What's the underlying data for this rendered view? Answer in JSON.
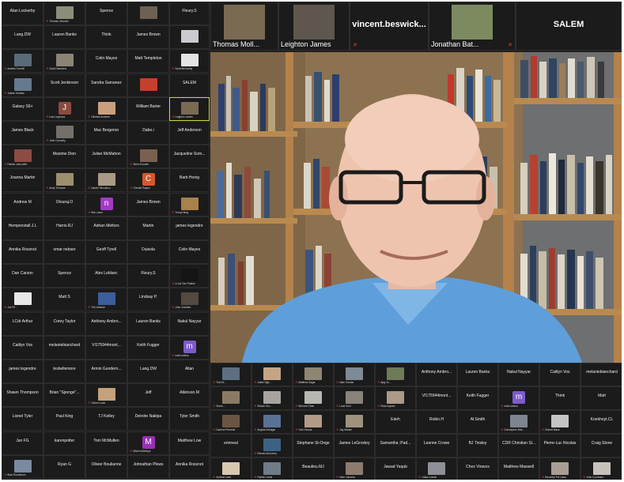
{
  "app": {
    "name": "Zoom gallery view"
  },
  "top_strip": [
    {
      "name": "Thomas Moll...",
      "kind": "video",
      "bg": "#7b6a52",
      "muted": false
    },
    {
      "name": "Leighton James",
      "kind": "video",
      "bg": "#5f564d",
      "muted": false
    },
    {
      "name": "vincent.beswick...",
      "kind": "name",
      "muted": true
    },
    {
      "name": "Jonathan Bat...",
      "kind": "video",
      "bg": "#7d8a60",
      "muted": true
    },
    {
      "name": "SALEM",
      "kind": "name",
      "muted": false
    }
  ],
  "active_speaker": {
    "label": "Active speaker video",
    "wall_color": "#8e7453",
    "shirt_color": "#5e9fdb"
  },
  "left_grid": [
    [
      "Alan Lockerby",
      {
        "thumb": "#8a8f7a",
        "label": "Thomas Vermiett"
      },
      "Spence",
      {
        "thumb": "#6d6252"
      },
      "Fleury.S"
    ],
    [
      "Lang.DW",
      "Lauren Banks",
      "Think",
      "James Brown",
      {
        "thumb": "#c9cbd0"
      }
    ],
    [
      {
        "thumb": "#5b6a78",
        "label": "andrew Tunnell"
      },
      {
        "thumb": "#8c8377",
        "label": "Sodhi Wardens"
      },
      "Colin Mayes",
      "Matt Templeton",
      {
        "thumb": "#e3e3e3",
        "label": "Scott McCarthy"
      }
    ],
    [
      {
        "thumb": "#657a8c",
        "label": "Jubran Kunbac"
      },
      "Scott Jenkinson",
      "Sandra Samanez",
      {
        "thumb": "#c4402e"
      },
      "SALEM"
    ],
    [
      "Galaxy S9+",
      {
        "init": "J",
        "color": "#8a4b3f",
        "label": "Ivan Leymans"
      },
      {
        "thumb": "#c9a07d",
        "label": "Gilmina Annetee"
      },
      "William Barter",
      {
        "thumb": "#7b6a52",
        "label": "Leighton James",
        "hl": true
      }
    ],
    [
      "James Black",
      {
        "thumb": "#73706a",
        "label": "John Connelly"
      },
      "Mac Bergeron",
      "Dabo.i",
      "Jeff Anderson"
    ],
    [
      {
        "thumb": "#8b4c43",
        "label": "Patrick Lamonthe"
      },
      "Maxime Dion",
      "Julian McMahon",
      {
        "thumb": "#7a6050",
        "label": "Steve Knowle"
      },
      "Jacqueline Som..."
    ],
    [
      "Joanna Martin",
      {
        "thumb": "#9c8f6e",
        "label": "Andy Terrance"
      },
      {
        "thumb": "#a89a84",
        "label": "Daniel Tchouikou"
      },
      {
        "init": "C",
        "color": "#d5582b",
        "label": "Christel Payton"
      },
      "Barb Honig"
    ],
    [
      "Andrew M",
      "Otsuraj.O",
      {
        "init": "n",
        "color": "#a33bc4",
        "label": "Bob Lauer"
      },
      "James Brown",
      {
        "thumb": "#a8814b",
        "label": "Trung Heng"
      }
    ],
    [
      "Hempenstall.J.L",
      "Harris.RJ",
      "Adrian Meltors",
      "Martin",
      "james legendre"
    ],
    [
      "Annika Rossnot",
      "omar nebser",
      "Geoff Tyrell",
      "Duisola",
      "Colin Mayes"
    ],
    [
      "Dan Carson",
      "Spence",
      "Alex Leblanc",
      "Fleury.S",
      {
        "thumb": "#151515",
        "label": "Lt-col Tom Pasker"
      }
    ],
    [
      {
        "thumb": "#e8e8e8",
        "label": "Joe Pil..."
      },
      "Matt S",
      {
        "thumb": "#3d5e9c",
        "label": "Tim Volstore"
      },
      "Lindsay P.",
      {
        "thumb": "#55493f",
        "label": "John Goulbert"
      }
    ],
    [
      "LCdr Arthur",
      "Corey Taylor",
      "Anthony Ambro...",
      "Lauren Banks",
      "Nakul Nayyar"
    ],
    [
      "Caitlyn Vos",
      "melaniebianchard",
      "VI175944mont...",
      "Keith Fugger",
      {
        "init": "m",
        "color": "#7c5bcb",
        "label": "matt comica"
      }
    ],
    [
      "james legendre",
      "lesbellemore",
      "Armin Gundern...",
      "Lang.DW",
      "Allan"
    ],
    [
      "Shawn Thompson",
      "Brian \"Sponge\"...",
      {
        "thumb": "#c4a27c",
        "label": "Calum Louin"
      },
      "Jeff",
      "Atkinson.M"
    ],
    [
      "Lionel Tyler",
      "Paul King",
      "TJ Kelley",
      "Deirdre Nakipa",
      "Tyler Smith"
    ],
    [
      "Jan FG",
      "karenpotter",
      "Tom McMullen",
      {
        "init": "M",
        "color": "#9a2fb8",
        "label": "Michel Allenbys"
      },
      "Matthew Low"
    ],
    [
      {
        "thumb": "#7a8aa0",
        "label": "Brad Ronderson"
      },
      "Ryan G",
      "Olivier Boulianne",
      "Johnathan Plews",
      "Annika Rossnot"
    ]
  ],
  "right_grid": [
    [
      {
        "thumb": "#5d6f80",
        "label": "Tom M..."
      },
      {
        "thumb": "#c5a585",
        "label": "Justin Ngh..."
      },
      {
        "thumb": "#8e8572",
        "label": "Matthew Zagar"
      },
      {
        "thumb": "#7e8a94",
        "label": "Nam Goolan"
      },
      {
        "thumb": "#6e7b58",
        "label": "Ajay Jo..."
      },
      "Anthony Ambro...",
      "Lauren Banks",
      "Nakul Nayyar",
      "Caitlyn Vos",
      "melaniebianchard"
    ],
    [
      {
        "thumb": "#8b7a63",
        "label": "Soren..."
      },
      {
        "thumb": "#a7a49f",
        "label": "Shawn Gro..."
      },
      {
        "thumb": "#b7b7b1",
        "label": "Bernard Chan"
      },
      {
        "thumb": "#87827a",
        "label": "Luuk Vind"
      },
      {
        "thumb": "#aa9a86",
        "label": "Ross Ingram"
      },
      "VI175944mont...",
      "Keith Fugger",
      {
        "init": "m",
        "color": "#7c5bcb",
        "label": "matt comica"
      },
      "Think",
      "Matt"
    ],
    [
      {
        "thumb": "#6a5545",
        "label": "Darlene Pierrede"
      },
      {
        "thumb": "#5a7196",
        "label": "Angela Delatgar"
      },
      {
        "thumb": "#b39b8a",
        "label": "Yuki Gionsa"
      },
      {
        "thumb": "#9e927e",
        "label": "Jay Mohan"
      },
      "Edeh",
      "Robin.H",
      "Al Smith",
      {
        "thumb": "#7d8590",
        "label": "Christopher Brie..."
      },
      {
        "thumb": "#c4c4c4",
        "label": "Robert Mack"
      },
      "Koekhoyt.CL"
    ],
    [
      "erinneal",
      {
        "thumb": "#3c6284",
        "label": "Renato Moronery"
      },
      "Stephane St-Onge",
      "James LeGroxley",
      "Samantha ;Pad...",
      "Leanne Crowe",
      "BJ Tinsley",
      "CDR Christian Sl...",
      "Pierre-Luc Nicolas",
      "Craig Stone"
    ],
    [
      {
        "thumb": "#d8c8b0",
        "label": "Andrew Lane"
      },
      {
        "thumb": "#6f7b87",
        "label": "Patrick Lewis"
      },
      "Beaulieu.MJ",
      {
        "thumb": "#8c7b6e",
        "label": "Nam Lamaha"
      },
      "Jawad Yaqub",
      {
        "thumb": "#8e9097",
        "label": "Julian Lotzan"
      },
      "Chez Viravos",
      "Matthew Maxwell",
      {
        "thumb": "#a79f94",
        "label": "Beverley Pui Lamu"
      },
      {
        "thumb": "#c7c3bb",
        "label": "John Cochrane"
      }
    ]
  ]
}
